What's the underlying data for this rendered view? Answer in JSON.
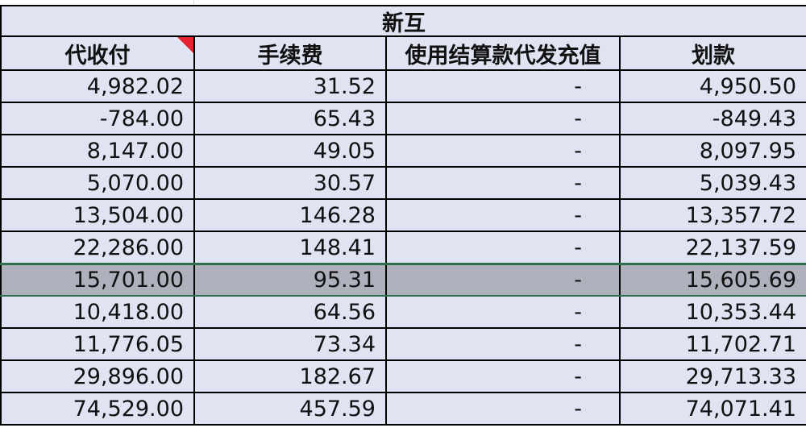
{
  "sheet": {
    "group_title": "新互",
    "headers": [
      "代收付",
      "手续费",
      "使用结算款代发充值",
      "划款"
    ],
    "rows": [
      [
        "4,982.02",
        "31.52",
        "-",
        "4,950.50"
      ],
      [
        "-784.00",
        "65.43",
        "-",
        "-849.43"
      ],
      [
        "8,147.00",
        "49.05",
        "-",
        "8,097.95"
      ],
      [
        "5,070.00",
        "30.57",
        "-",
        "5,039.43"
      ],
      [
        "13,504.00",
        "146.28",
        "-",
        "13,357.72"
      ],
      [
        "22,286.00",
        "148.41",
        "-",
        "22,137.59"
      ],
      [
        "15,701.00",
        "95.31",
        "-",
        "15,605.69"
      ],
      [
        "10,418.00",
        "64.56",
        "-",
        "10,353.44"
      ],
      [
        "11,776.05",
        "73.34",
        "-",
        "11,702.71"
      ],
      [
        "29,896.00",
        "182.67",
        "-",
        "29,713.33"
      ],
      [
        "74,529.00",
        "457.59",
        "-",
        "74,071.41"
      ]
    ],
    "selected_row_index": 6,
    "colors": {
      "cell_fill": "#dfe3f2",
      "selected_fill": "#aeb1bc",
      "selection_border": "#2f6f4f",
      "comment_flag": "#e5232e",
      "border": "#000000"
    }
  }
}
